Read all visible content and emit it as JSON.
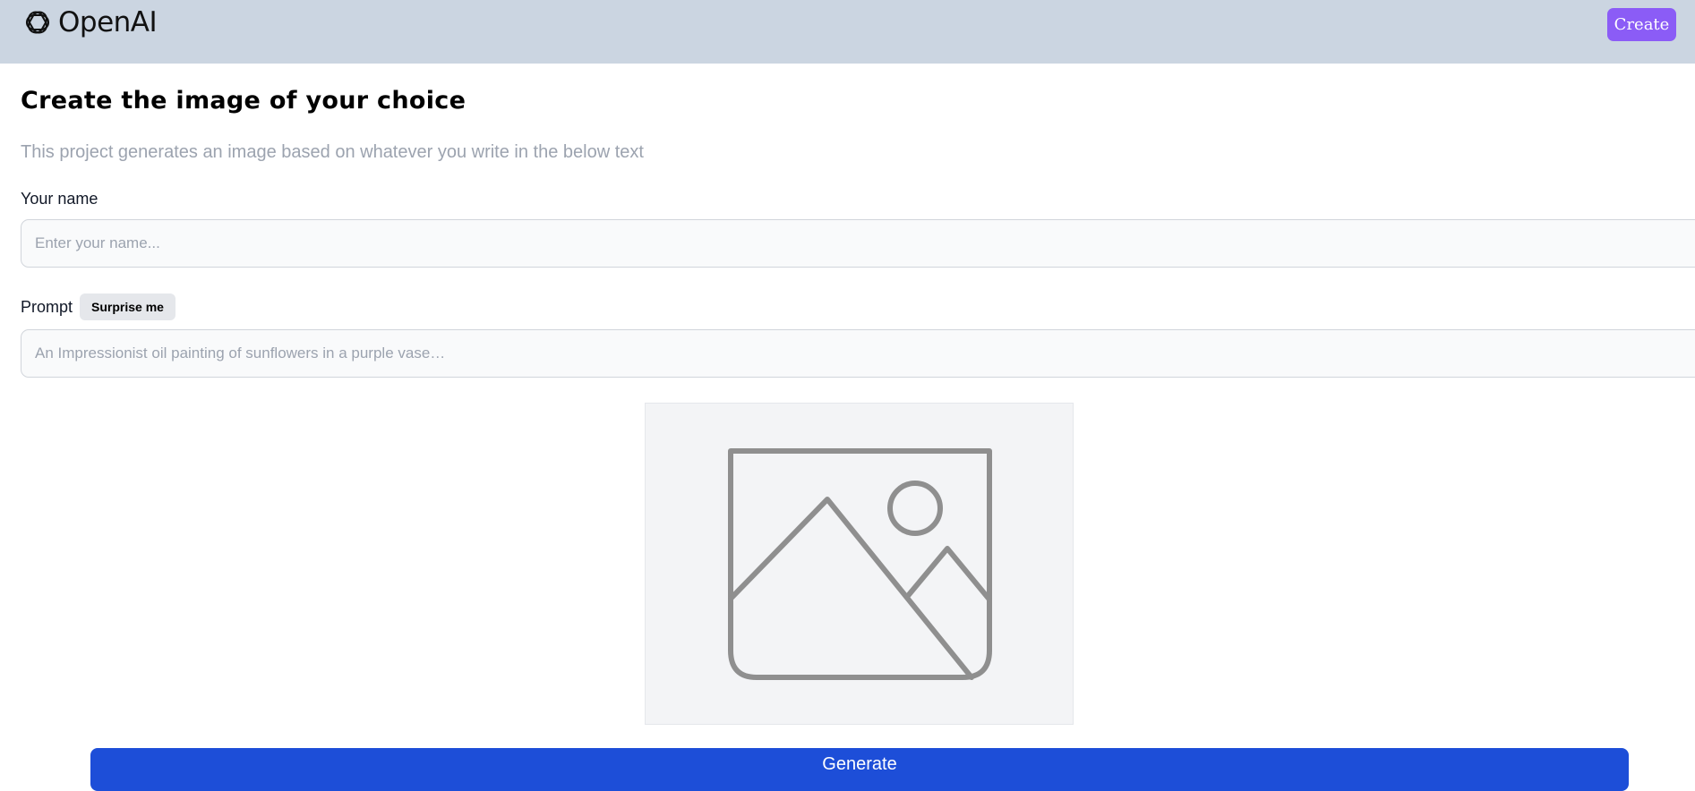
{
  "header": {
    "logo_text": "OpenAI",
    "logo_icon": "openai-logo-icon",
    "create_label": "Create",
    "background": "#cbd5e1",
    "create_color": "#8b5cf6"
  },
  "main": {
    "title": "Create the image of your choice",
    "subtitle": "This project generates an image based on whatever you write in the below text",
    "name_label": "Your name",
    "name_placeholder": "Enter your name...",
    "name_value": "",
    "prompt_label": "Prompt",
    "surprise_label": "Surprise me",
    "prompt_placeholder": "An Impressionist oil painting of sunflowers in a purple vase…",
    "prompt_value": "",
    "preview_icon": "image-placeholder-icon",
    "generate_label": "Generate",
    "generate_color": "#1d4ed8"
  }
}
